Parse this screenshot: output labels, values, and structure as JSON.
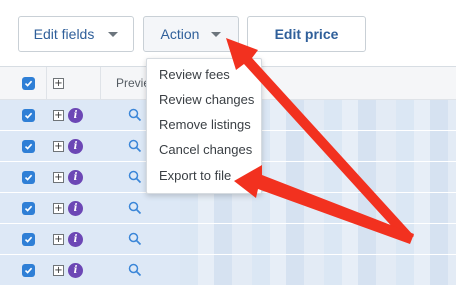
{
  "toolbar": {
    "edit_fields_label": "Edit fields",
    "action_label": "Action",
    "edit_price_label": "Edit price"
  },
  "grid": {
    "header": {
      "preview_label": "Previe"
    },
    "row_count": 6
  },
  "action_menu": {
    "items": [
      {
        "label": "Review fees"
      },
      {
        "label": "Review changes"
      },
      {
        "label": "Remove listings"
      },
      {
        "label": "Cancel changes"
      },
      {
        "label": "Export to file"
      }
    ]
  },
  "colors": {
    "accent_blue": "#2f7fd6",
    "link_text": "#2f5f9a",
    "info_badge": "#6c47b5",
    "selected_row": "#dde8f6",
    "annotation_arrow": "#f2311f"
  },
  "icons": {
    "checkbox": "checkbox-checked-icon",
    "expand": "plus-square-icon",
    "info": "info-icon",
    "preview": "magnifier-icon",
    "caret": "caret-down-icon"
  }
}
